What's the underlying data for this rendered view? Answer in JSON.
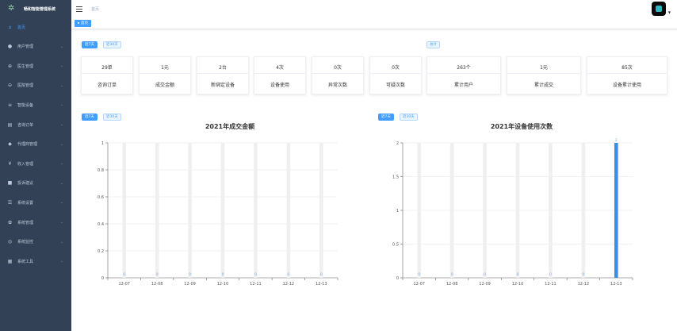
{
  "app": {
    "title": "畅和智能管理系统"
  },
  "sidebar": {
    "items": [
      {
        "label": "首页",
        "icon": "home-icon",
        "glyph": "⌂",
        "active": true,
        "arrow": false
      },
      {
        "label": "用户管理",
        "icon": "user-icon",
        "glyph": "●",
        "active": false,
        "arrow": true
      },
      {
        "label": "医生管理",
        "icon": "doctor-icon",
        "glyph": "⊕",
        "active": false,
        "arrow": true
      },
      {
        "label": "医院管理",
        "icon": "hospital-icon",
        "glyph": "⊖",
        "active": false,
        "arrow": true
      },
      {
        "label": "智能设备",
        "icon": "device-icon",
        "glyph": "≡",
        "active": false,
        "arrow": true
      },
      {
        "label": "咨询订单",
        "icon": "order-icon",
        "glyph": "▤",
        "active": false,
        "arrow": true
      },
      {
        "label": "代理商管理",
        "icon": "agent-icon",
        "glyph": "◆",
        "active": false,
        "arrow": true
      },
      {
        "label": "收入管理",
        "icon": "yen-icon",
        "glyph": "¥",
        "active": false,
        "arrow": true
      },
      {
        "label": "投诉建议",
        "icon": "feedback-icon",
        "glyph": "■",
        "active": false,
        "arrow": true
      },
      {
        "label": "系统设置",
        "icon": "settings-list-icon",
        "glyph": "☰",
        "active": false,
        "arrow": true
      },
      {
        "label": "系统管理",
        "icon": "gear-icon",
        "glyph": "✿",
        "active": false,
        "arrow": true
      },
      {
        "label": "系统监控",
        "icon": "monitor-icon",
        "glyph": "◎",
        "active": false,
        "arrow": true
      },
      {
        "label": "系统工具",
        "icon": "tools-icon",
        "glyph": "▦",
        "active": false,
        "arrow": true
      }
    ]
  },
  "header": {
    "breadcrumb": "首页"
  },
  "tags": {
    "home": "首页"
  },
  "filters": {
    "last7": "近7天",
    "last30": "近30天",
    "total": "总计"
  },
  "stats": [
    {
      "value": "29单",
      "label": "咨询订单"
    },
    {
      "value": "1元",
      "label": "成交金额"
    },
    {
      "value": "2台",
      "label": "新绑定设备"
    },
    {
      "value": "4次",
      "label": "设备使用"
    },
    {
      "value": "0次",
      "label": "异常次数"
    },
    {
      "value": "0次",
      "label": "可疑次数"
    },
    {
      "value": "263个",
      "label": "累计用户"
    },
    {
      "value": "1元",
      "label": "累计成交"
    },
    {
      "value": "85次",
      "label": "设备累计使用"
    }
  ],
  "chart_data": [
    {
      "type": "bar",
      "title": "2021年成交金额",
      "categories": [
        "12-07",
        "12-08",
        "12-09",
        "12-10",
        "12-11",
        "12-12",
        "12-13"
      ],
      "values": [
        0,
        0,
        0,
        0,
        0,
        0,
        0
      ],
      "data_labels": [
        "0",
        "0",
        "0",
        "0",
        "0",
        "0",
        "0"
      ],
      "yticks": [
        "0",
        "0.2",
        "0.4",
        "0.6",
        "0.8",
        "1"
      ],
      "ylim": [
        0,
        1
      ],
      "bar_color": "#3a8ee6",
      "background_bar_color": "#efefef",
      "grid": true
    },
    {
      "type": "bar",
      "title": "2021年设备使用次数",
      "categories": [
        "12-07",
        "12-08",
        "12-09",
        "12-10",
        "12-11",
        "12-12",
        "12-13"
      ],
      "values": [
        0,
        0,
        0,
        0,
        0,
        0,
        2
      ],
      "data_labels": [
        "0",
        "0",
        "0",
        "0",
        "0",
        "0",
        "2"
      ],
      "yticks": [
        "0",
        "0.5",
        "1",
        "1.5",
        "2"
      ],
      "ylim": [
        0,
        2
      ],
      "bar_color": "#3a8ee6",
      "background_bar_color": "#efefef",
      "grid": true
    }
  ]
}
